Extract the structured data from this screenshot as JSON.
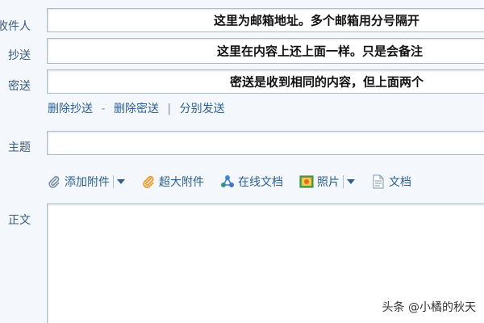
{
  "fields": {
    "recipient": {
      "label": "收件人",
      "value": "这里为邮箱地址。多个邮箱用分号隔开"
    },
    "cc": {
      "label": "抄送",
      "value": "这里在内容上还上面一样。只是会备注"
    },
    "bcc": {
      "label": "密送",
      "value": "密送是收到相同的内容，但上面两个"
    },
    "subject": {
      "label": "主题",
      "value": ""
    },
    "body": {
      "label": "正文"
    }
  },
  "links": {
    "remove_cc": "删除抄送",
    "dash": "-",
    "remove_bcc": "删除密送",
    "pipe": "|",
    "send_separately": "分别发送"
  },
  "toolbar": {
    "add_attachment": "添加附件",
    "large_attachment": "超大附件",
    "online_doc": "在线文档",
    "photo": "照片",
    "document": "文档"
  },
  "icons": {
    "add_attachment": "paperclip-icon",
    "large_attachment": "paperclip-orange-icon",
    "online_doc": "cloud-doc-icon",
    "photo": "photo-icon",
    "document": "document-icon"
  },
  "colors": {
    "background": "#f4f8fc",
    "field_border": "#a9bdd0",
    "label": "#3a5a7a",
    "link": "#2c5f94"
  },
  "watermark": "头条 @小橘的秋天"
}
